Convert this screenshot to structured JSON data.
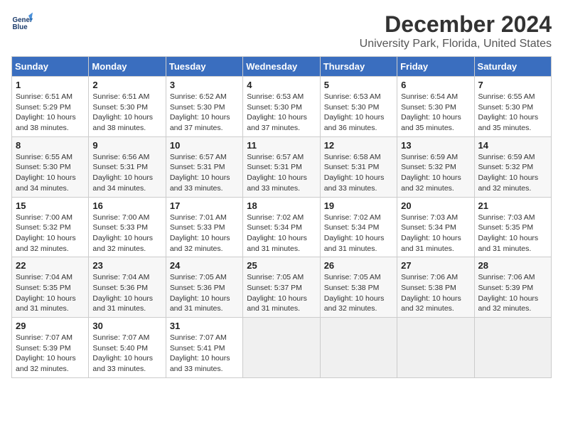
{
  "header": {
    "logo_line1": "General",
    "logo_line2": "Blue",
    "month": "December 2024",
    "location": "University Park, Florida, United States"
  },
  "days_of_week": [
    "Sunday",
    "Monday",
    "Tuesday",
    "Wednesday",
    "Thursday",
    "Friday",
    "Saturday"
  ],
  "weeks": [
    [
      {
        "day": "1",
        "info": "Sunrise: 6:51 AM\nSunset: 5:29 PM\nDaylight: 10 hours\nand 38 minutes."
      },
      {
        "day": "2",
        "info": "Sunrise: 6:51 AM\nSunset: 5:30 PM\nDaylight: 10 hours\nand 38 minutes."
      },
      {
        "day": "3",
        "info": "Sunrise: 6:52 AM\nSunset: 5:30 PM\nDaylight: 10 hours\nand 37 minutes."
      },
      {
        "day": "4",
        "info": "Sunrise: 6:53 AM\nSunset: 5:30 PM\nDaylight: 10 hours\nand 37 minutes."
      },
      {
        "day": "5",
        "info": "Sunrise: 6:53 AM\nSunset: 5:30 PM\nDaylight: 10 hours\nand 36 minutes."
      },
      {
        "day": "6",
        "info": "Sunrise: 6:54 AM\nSunset: 5:30 PM\nDaylight: 10 hours\nand 35 minutes."
      },
      {
        "day": "7",
        "info": "Sunrise: 6:55 AM\nSunset: 5:30 PM\nDaylight: 10 hours\nand 35 minutes."
      }
    ],
    [
      {
        "day": "8",
        "info": "Sunrise: 6:55 AM\nSunset: 5:30 PM\nDaylight: 10 hours\nand 34 minutes."
      },
      {
        "day": "9",
        "info": "Sunrise: 6:56 AM\nSunset: 5:31 PM\nDaylight: 10 hours\nand 34 minutes."
      },
      {
        "day": "10",
        "info": "Sunrise: 6:57 AM\nSunset: 5:31 PM\nDaylight: 10 hours\nand 33 minutes."
      },
      {
        "day": "11",
        "info": "Sunrise: 6:57 AM\nSunset: 5:31 PM\nDaylight: 10 hours\nand 33 minutes."
      },
      {
        "day": "12",
        "info": "Sunrise: 6:58 AM\nSunset: 5:31 PM\nDaylight: 10 hours\nand 33 minutes."
      },
      {
        "day": "13",
        "info": "Sunrise: 6:59 AM\nSunset: 5:32 PM\nDaylight: 10 hours\nand 32 minutes."
      },
      {
        "day": "14",
        "info": "Sunrise: 6:59 AM\nSunset: 5:32 PM\nDaylight: 10 hours\nand 32 minutes."
      }
    ],
    [
      {
        "day": "15",
        "info": "Sunrise: 7:00 AM\nSunset: 5:32 PM\nDaylight: 10 hours\nand 32 minutes."
      },
      {
        "day": "16",
        "info": "Sunrise: 7:00 AM\nSunset: 5:33 PM\nDaylight: 10 hours\nand 32 minutes."
      },
      {
        "day": "17",
        "info": "Sunrise: 7:01 AM\nSunset: 5:33 PM\nDaylight: 10 hours\nand 32 minutes."
      },
      {
        "day": "18",
        "info": "Sunrise: 7:02 AM\nSunset: 5:34 PM\nDaylight: 10 hours\nand 31 minutes."
      },
      {
        "day": "19",
        "info": "Sunrise: 7:02 AM\nSunset: 5:34 PM\nDaylight: 10 hours\nand 31 minutes."
      },
      {
        "day": "20",
        "info": "Sunrise: 7:03 AM\nSunset: 5:34 PM\nDaylight: 10 hours\nand 31 minutes."
      },
      {
        "day": "21",
        "info": "Sunrise: 7:03 AM\nSunset: 5:35 PM\nDaylight: 10 hours\nand 31 minutes."
      }
    ],
    [
      {
        "day": "22",
        "info": "Sunrise: 7:04 AM\nSunset: 5:35 PM\nDaylight: 10 hours\nand 31 minutes."
      },
      {
        "day": "23",
        "info": "Sunrise: 7:04 AM\nSunset: 5:36 PM\nDaylight: 10 hours\nand 31 minutes."
      },
      {
        "day": "24",
        "info": "Sunrise: 7:05 AM\nSunset: 5:36 PM\nDaylight: 10 hours\nand 31 minutes."
      },
      {
        "day": "25",
        "info": "Sunrise: 7:05 AM\nSunset: 5:37 PM\nDaylight: 10 hours\nand 31 minutes."
      },
      {
        "day": "26",
        "info": "Sunrise: 7:05 AM\nSunset: 5:38 PM\nDaylight: 10 hours\nand 32 minutes."
      },
      {
        "day": "27",
        "info": "Sunrise: 7:06 AM\nSunset: 5:38 PM\nDaylight: 10 hours\nand 32 minutes."
      },
      {
        "day": "28",
        "info": "Sunrise: 7:06 AM\nSunset: 5:39 PM\nDaylight: 10 hours\nand 32 minutes."
      }
    ],
    [
      {
        "day": "29",
        "info": "Sunrise: 7:07 AM\nSunset: 5:39 PM\nDaylight: 10 hours\nand 32 minutes."
      },
      {
        "day": "30",
        "info": "Sunrise: 7:07 AM\nSunset: 5:40 PM\nDaylight: 10 hours\nand 33 minutes."
      },
      {
        "day": "31",
        "info": "Sunrise: 7:07 AM\nSunset: 5:41 PM\nDaylight: 10 hours\nand 33 minutes."
      },
      {
        "day": "",
        "info": ""
      },
      {
        "day": "",
        "info": ""
      },
      {
        "day": "",
        "info": ""
      },
      {
        "day": "",
        "info": ""
      }
    ]
  ]
}
